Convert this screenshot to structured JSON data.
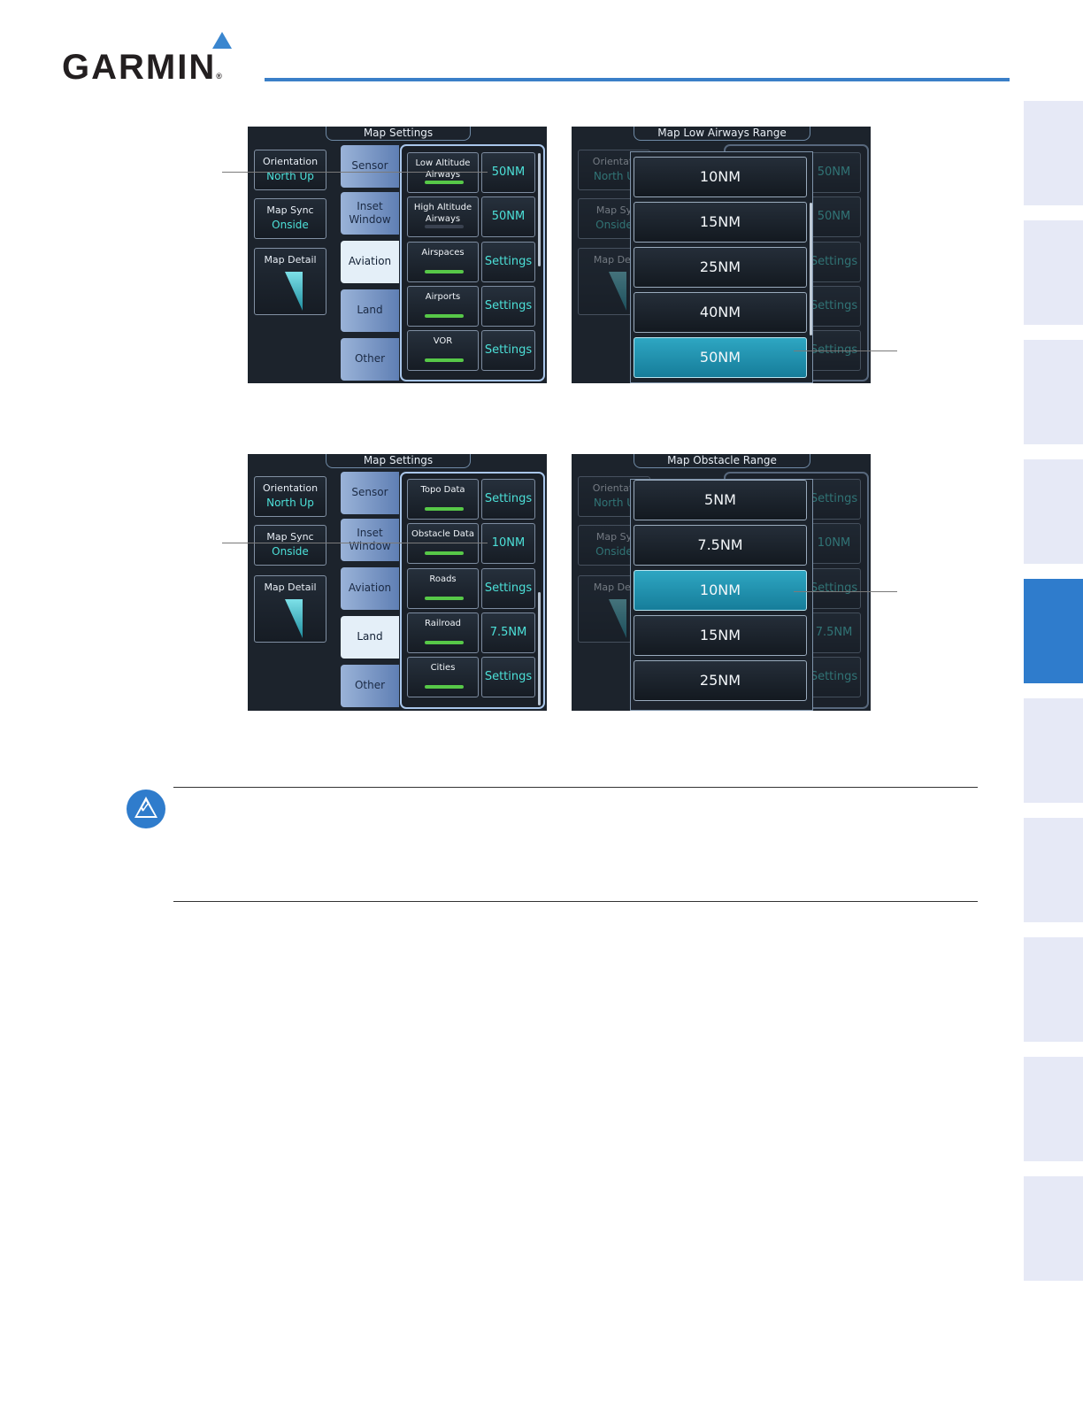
{
  "header": {
    "brand": "GARMIN",
    "registered_mark": "®"
  },
  "colors": {
    "accent": "#2f7ccc",
    "active_value": "#4ce0d8",
    "enabled_bar": "#57c848"
  },
  "screen1": {
    "title": "Map Settings",
    "left": {
      "orientation_label": "Orientation",
      "orientation_value": "North Up",
      "sync_label": "Map Sync",
      "sync_value": "Onside",
      "detail_label": "Map Detail"
    },
    "tabs": [
      "Sensor",
      "Inset Window",
      "Aviation",
      "Land",
      "Other"
    ],
    "rows": [
      {
        "name": "Low Altitude Airways",
        "value": "50NM"
      },
      {
        "name": "High Altitude Airways",
        "value": "50NM"
      },
      {
        "name": "Airspaces",
        "value": "Settings"
      },
      {
        "name": "Airports",
        "value": "Settings"
      },
      {
        "name": "VOR",
        "value": "Settings"
      }
    ]
  },
  "screen2": {
    "title": "Map Low Airways Range",
    "options": [
      "10NM",
      "15NM",
      "25NM",
      "40NM",
      "50NM"
    ],
    "background": {
      "orientation_label": "Orientati",
      "orientation_value": "North U",
      "sync_label": "Map Sy",
      "sync_value": "Onside",
      "detail_label": "Map Det",
      "values": [
        "50NM",
        "50NM",
        "Settings",
        "Settings",
        "Settings"
      ]
    }
  },
  "screen3": {
    "title": "Map Settings",
    "left": {
      "orientation_label": "Orientation",
      "orientation_value": "North Up",
      "sync_label": "Map Sync",
      "sync_value": "Onside",
      "detail_label": "Map Detail"
    },
    "tabs": [
      "Sensor",
      "Inset Window",
      "Aviation",
      "Land",
      "Other"
    ],
    "rows": [
      {
        "name": "Topo Data",
        "value": "Settings"
      },
      {
        "name": "Obstacle Data",
        "value": "10NM"
      },
      {
        "name": "Roads",
        "value": "Settings"
      },
      {
        "name": "Railroad",
        "value": "7.5NM"
      },
      {
        "name": "Cities",
        "value": "Settings"
      }
    ]
  },
  "screen4": {
    "title": "Map Obstacle Range",
    "options": [
      "5NM",
      "7.5NM",
      "10NM",
      "15NM",
      "25NM"
    ],
    "background": {
      "orientation_label": "Orientati",
      "orientation_value": "North U",
      "sync_label": "Map Sy",
      "sync_value": "Onside",
      "detail_label": "Map Det",
      "values": [
        "Settings",
        "10NM",
        "Settings",
        "7.5NM",
        "Settings"
      ]
    }
  }
}
